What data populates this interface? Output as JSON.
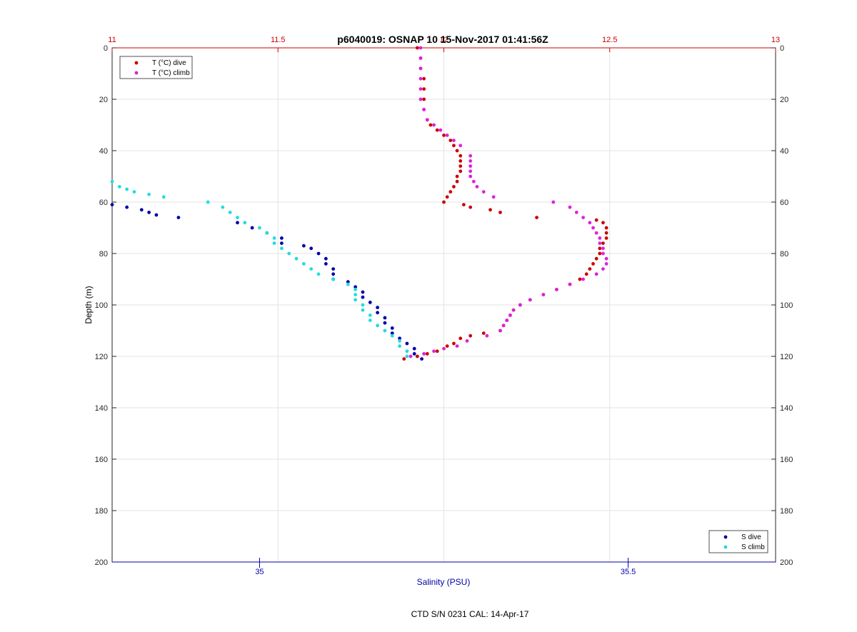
{
  "chart_data": {
    "type": "scatter",
    "title": "p6040019: OSNAP 10 15-Nov-2017 01:41:56Z",
    "ylabel": "Depth (m)",
    "xlabel_bottom": "Salinity (PSU)",
    "footer": "CTD S/N 0231  CAL: 14-Apr-17",
    "ylim": [
      0,
      200
    ],
    "y_reversed": true,
    "y_ticks": [
      "0",
      "20",
      "40",
      "60",
      "80",
      "100",
      "120",
      "140",
      "160",
      "180",
      "200"
    ],
    "top_axis": {
      "quantity": "T",
      "lim": [
        11,
        13
      ],
      "ticks": [
        "11",
        "11.5",
        "12",
        "12.5",
        "13"
      ],
      "color": "#cc0000"
    },
    "bottom_axis": {
      "quantity": "S",
      "lim": [
        34.8,
        35.7
      ],
      "ticks": [
        "35",
        "35.5"
      ],
      "color": "#0000aa"
    },
    "grid": true,
    "legend_top": {
      "placement": "top-left",
      "entries": [
        "T (°C) dive",
        "T (°C) climb"
      ]
    },
    "legend_bottom": {
      "placement": "bottom-right",
      "entries": [
        "S dive",
        "S climb"
      ]
    },
    "series": [
      {
        "name": "T (°C) dive",
        "axis": "top",
        "color": "#cc0000",
        "points": [
          [
            11.92,
            0
          ],
          [
            11.93,
            4
          ],
          [
            11.93,
            8
          ],
          [
            11.94,
            12
          ],
          [
            11.94,
            16
          ],
          [
            11.94,
            20
          ],
          [
            11.94,
            24
          ],
          [
            11.95,
            28
          ],
          [
            11.96,
            30
          ],
          [
            11.98,
            32
          ],
          [
            12.0,
            34
          ],
          [
            12.02,
            36
          ],
          [
            12.03,
            38
          ],
          [
            12.04,
            40
          ],
          [
            12.05,
            42
          ],
          [
            12.05,
            44
          ],
          [
            12.05,
            46
          ],
          [
            12.05,
            48
          ],
          [
            12.04,
            50
          ],
          [
            12.04,
            52
          ],
          [
            12.03,
            54
          ],
          [
            12.02,
            56
          ],
          [
            12.01,
            58
          ],
          [
            12.0,
            60
          ],
          [
            12.06,
            61
          ],
          [
            12.08,
            62
          ],
          [
            12.14,
            63
          ],
          [
            12.17,
            64
          ],
          [
            12.28,
            66
          ],
          [
            12.46,
            67
          ],
          [
            12.48,
            68
          ],
          [
            12.49,
            70
          ],
          [
            12.49,
            72
          ],
          [
            12.49,
            74
          ],
          [
            12.48,
            76
          ],
          [
            12.47,
            78
          ],
          [
            12.47,
            80
          ],
          [
            12.46,
            82
          ],
          [
            12.45,
            84
          ],
          [
            12.44,
            86
          ],
          [
            12.43,
            88
          ],
          [
            12.41,
            90
          ],
          [
            12.38,
            92
          ],
          [
            12.34,
            94
          ],
          [
            12.3,
            96
          ],
          [
            12.26,
            98
          ],
          [
            12.23,
            100
          ],
          [
            12.21,
            102
          ],
          [
            12.2,
            104
          ],
          [
            12.19,
            106
          ],
          [
            12.18,
            108
          ],
          [
            12.17,
            110
          ],
          [
            12.12,
            111
          ],
          [
            12.08,
            112
          ],
          [
            12.05,
            113
          ],
          [
            12.03,
            115
          ],
          [
            12.01,
            116
          ],
          [
            11.98,
            118
          ],
          [
            11.95,
            119
          ],
          [
            11.92,
            120
          ],
          [
            11.88,
            121
          ]
        ]
      },
      {
        "name": "T (°C) climb",
        "axis": "top",
        "color": "#dd22dd",
        "points": [
          [
            11.93,
            0
          ],
          [
            11.93,
            4
          ],
          [
            11.93,
            8
          ],
          [
            11.93,
            12
          ],
          [
            11.93,
            16
          ],
          [
            11.93,
            20
          ],
          [
            11.94,
            24
          ],
          [
            11.95,
            28
          ],
          [
            11.97,
            30
          ],
          [
            11.99,
            32
          ],
          [
            12.01,
            34
          ],
          [
            12.03,
            36
          ],
          [
            12.05,
            38
          ],
          [
            12.08,
            42
          ],
          [
            12.08,
            44
          ],
          [
            12.08,
            46
          ],
          [
            12.08,
            48
          ],
          [
            12.08,
            50
          ],
          [
            12.09,
            52
          ],
          [
            12.1,
            54
          ],
          [
            12.12,
            56
          ],
          [
            12.15,
            58
          ],
          [
            12.33,
            60
          ],
          [
            12.38,
            62
          ],
          [
            12.4,
            64
          ],
          [
            12.42,
            66
          ],
          [
            12.44,
            68
          ],
          [
            12.45,
            70
          ],
          [
            12.46,
            72
          ],
          [
            12.47,
            74
          ],
          [
            12.47,
            76
          ],
          [
            12.48,
            78
          ],
          [
            12.48,
            80
          ],
          [
            12.49,
            82
          ],
          [
            12.49,
            84
          ],
          [
            12.48,
            86
          ],
          [
            12.46,
            88
          ],
          [
            12.42,
            90
          ],
          [
            12.38,
            92
          ],
          [
            12.34,
            94
          ],
          [
            12.3,
            96
          ],
          [
            12.26,
            98
          ],
          [
            12.23,
            100
          ],
          [
            12.21,
            102
          ],
          [
            12.2,
            104
          ],
          [
            12.19,
            106
          ],
          [
            12.18,
            108
          ],
          [
            12.17,
            110
          ],
          [
            12.13,
            112
          ],
          [
            12.07,
            114
          ],
          [
            12.04,
            116
          ],
          [
            12.0,
            117
          ],
          [
            11.97,
            118
          ],
          [
            11.94,
            119
          ],
          [
            11.9,
            120
          ]
        ]
      },
      {
        "name": "S dive",
        "axis": "bottom",
        "color": "#0000aa",
        "points": [
          [
            34.8,
            61
          ],
          [
            34.82,
            62
          ],
          [
            34.84,
            63
          ],
          [
            34.85,
            64
          ],
          [
            34.86,
            65
          ],
          [
            34.89,
            66
          ],
          [
            34.97,
            68
          ],
          [
            34.99,
            70
          ],
          [
            35.01,
            72
          ],
          [
            35.03,
            74
          ],
          [
            35.03,
            76
          ],
          [
            35.06,
            77
          ],
          [
            35.07,
            78
          ],
          [
            35.08,
            80
          ],
          [
            35.09,
            82
          ],
          [
            35.09,
            84
          ],
          [
            35.1,
            86
          ],
          [
            35.1,
            88
          ],
          [
            35.1,
            90
          ],
          [
            35.12,
            91
          ],
          [
            35.13,
            93
          ],
          [
            35.14,
            95
          ],
          [
            35.14,
            97
          ],
          [
            35.15,
            99
          ],
          [
            35.16,
            101
          ],
          [
            35.16,
            103
          ],
          [
            35.17,
            105
          ],
          [
            35.17,
            107
          ],
          [
            35.18,
            109
          ],
          [
            35.18,
            111
          ],
          [
            35.19,
            113
          ],
          [
            35.2,
            115
          ],
          [
            35.21,
            117
          ],
          [
            35.21,
            119
          ],
          [
            35.22,
            121
          ]
        ]
      },
      {
        "name": "S climb",
        "axis": "bottom",
        "color": "#22dddd",
        "points": [
          [
            34.8,
            52
          ],
          [
            34.81,
            54
          ],
          [
            34.82,
            55
          ],
          [
            34.83,
            56
          ],
          [
            34.85,
            57
          ],
          [
            34.87,
            58
          ],
          [
            34.93,
            60
          ],
          [
            34.95,
            62
          ],
          [
            34.96,
            64
          ],
          [
            34.97,
            66
          ],
          [
            34.98,
            68
          ],
          [
            35.0,
            70
          ],
          [
            35.01,
            72
          ],
          [
            35.02,
            74
          ],
          [
            35.02,
            76
          ],
          [
            35.03,
            78
          ],
          [
            35.04,
            80
          ],
          [
            35.05,
            82
          ],
          [
            35.06,
            84
          ],
          [
            35.07,
            86
          ],
          [
            35.08,
            88
          ],
          [
            35.1,
            90
          ],
          [
            35.12,
            92
          ],
          [
            35.13,
            94
          ],
          [
            35.13,
            96
          ],
          [
            35.13,
            98
          ],
          [
            35.14,
            100
          ],
          [
            35.14,
            102
          ],
          [
            35.15,
            104
          ],
          [
            35.15,
            106
          ],
          [
            35.16,
            108
          ],
          [
            35.17,
            110
          ],
          [
            35.18,
            112
          ],
          [
            35.19,
            114
          ],
          [
            35.19,
            116
          ],
          [
            35.2,
            118
          ],
          [
            35.2,
            120
          ]
        ]
      }
    ]
  }
}
